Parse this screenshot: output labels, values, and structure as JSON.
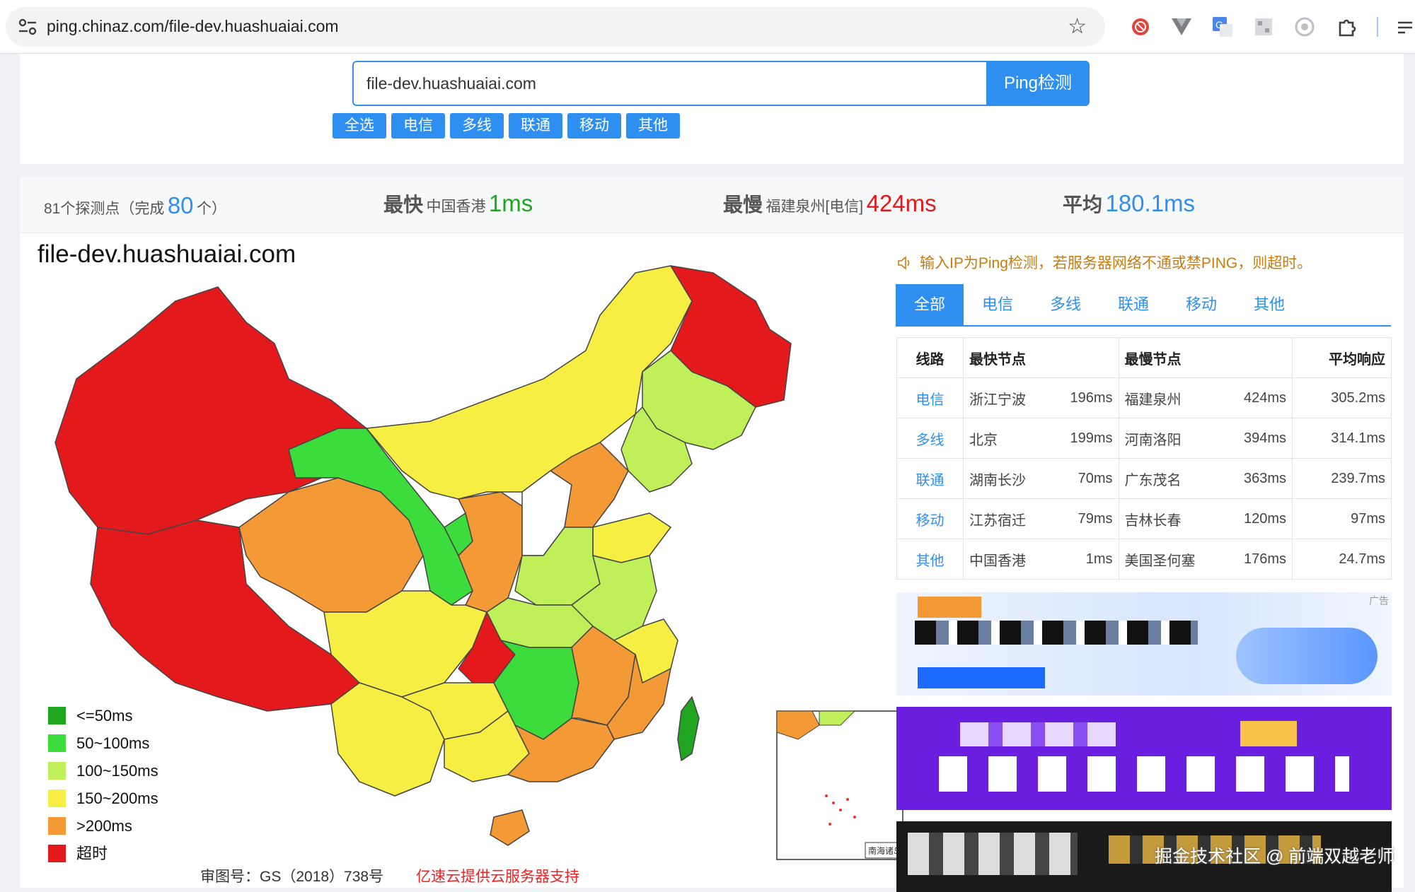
{
  "browser": {
    "url": "ping.chinaz.com/file-dev.huashuaiai.com"
  },
  "search": {
    "value": "file-dev.huashuaiai.com",
    "button": "Ping检测",
    "chips": [
      "全选",
      "电信",
      "多线",
      "联通",
      "移动",
      "其他"
    ]
  },
  "stats": {
    "count_prefix": "81个探测点（完成",
    "count_done": "80",
    "count_suffix": "个）",
    "fastest_label": "最快",
    "fastest_node": "中国香港",
    "fastest_value": "1ms",
    "slowest_label": "最慢",
    "slowest_node": "福建泉州[电信]",
    "slowest_value": "424ms",
    "avg_label": "平均",
    "avg_value": "180.1ms"
  },
  "map": {
    "title": "file-dev.huashuaiai.com",
    "legend": [
      {
        "label": "<=50ms",
        "color": "#1fa51f"
      },
      {
        "label": "50~100ms",
        "color": "#3ddc3d"
      },
      {
        "label": "100~150ms",
        "color": "#bff05a"
      },
      {
        "label": "150~200ms",
        "color": "#f7ee44"
      },
      {
        "label": ">200ms",
        "color": "#f39a36"
      },
      {
        "label": "超时",
        "color": "#e3191b"
      }
    ],
    "credit_left": "审图号：GS（2018）738号",
    "credit_right": "亿速云提供云服务器支持",
    "inset_label": "南海诸岛"
  },
  "notice": "输入IP为Ping检测，若服务器网络不通或禁PING，则超时。",
  "tabs": [
    "全部",
    "电信",
    "多线",
    "联通",
    "移动",
    "其他"
  ],
  "table": {
    "headers": [
      "线路",
      "最快节点",
      "最慢节点",
      "平均响应"
    ],
    "rows": [
      {
        "line": "电信",
        "fast_node": "浙江宁波",
        "fast_ms": "196ms",
        "slow_node": "福建泉州",
        "slow_ms": "424ms",
        "avg": "305.2ms"
      },
      {
        "line": "多线",
        "fast_node": "北京",
        "fast_ms": "199ms",
        "slow_node": "河南洛阳",
        "slow_ms": "394ms",
        "avg": "314.1ms"
      },
      {
        "line": "联通",
        "fast_node": "湖南长沙",
        "fast_ms": "70ms",
        "slow_node": "广东茂名",
        "slow_ms": "363ms",
        "avg": "239.7ms"
      },
      {
        "line": "移动",
        "fast_node": "江苏宿迁",
        "fast_ms": "79ms",
        "slow_node": "吉林长春",
        "slow_ms": "120ms",
        "avg": "97ms"
      },
      {
        "line": "其他",
        "fast_node": "中国香港",
        "fast_ms": "1ms",
        "slow_node": "美国圣何塞",
        "slow_ms": "176ms",
        "avg": "24.7ms"
      }
    ]
  },
  "ads": {
    "label": "广告"
  },
  "watermark": "掘金技术社区 @ 前端双越老师"
}
